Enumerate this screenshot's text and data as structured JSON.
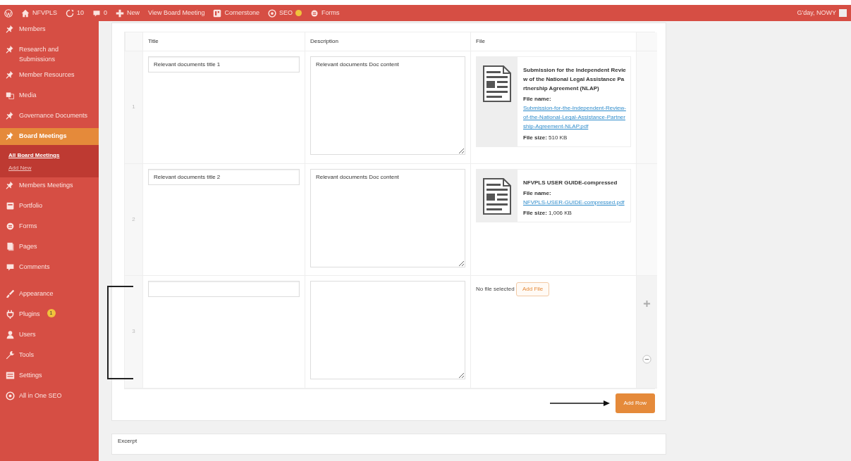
{
  "admin_bar": {
    "items": [
      {
        "kind": "wp-logo"
      },
      {
        "kind": "home",
        "label": "NFVPLS"
      },
      {
        "kind": "updates",
        "label": "10"
      },
      {
        "kind": "comments",
        "label": "0"
      },
      {
        "kind": "new",
        "label": "New"
      },
      {
        "kind": "text",
        "label": "View Board Meeting"
      },
      {
        "kind": "cornerstone",
        "label": "Cornerstone"
      },
      {
        "kind": "seo",
        "label": "SEO",
        "notice": true
      },
      {
        "kind": "forms",
        "label": "Forms"
      }
    ],
    "greeting": "G'day, NOWY"
  },
  "sidebar": {
    "items": [
      {
        "label": "Members",
        "selected": false
      },
      {
        "label": "Research and Submissions",
        "selected": false
      },
      {
        "label": "Member Resources",
        "selected": false
      },
      {
        "label": "Media",
        "selected": false
      },
      {
        "label": "Governance Documents",
        "selected": false
      },
      {
        "label": "Board Meetings",
        "selected": true,
        "children": [
          {
            "label": "All Board Meetings",
            "selected": true
          },
          {
            "label": "Add New",
            "selected": false
          }
        ]
      },
      {
        "label": "Members Meetings",
        "selected": false
      },
      {
        "label": "Portfolio",
        "selected": false
      },
      {
        "label": "Forms",
        "selected": false
      },
      {
        "label": "Pages",
        "selected": false
      },
      {
        "label": "Comments",
        "selected": false
      },
      {
        "label": "Appearance",
        "selected": false
      },
      {
        "label": "Plugins",
        "selected": false,
        "badge": "1"
      },
      {
        "label": "Users",
        "selected": false
      },
      {
        "label": "Tools",
        "selected": false
      },
      {
        "label": "Settings",
        "selected": false
      },
      {
        "label": "All in One SEO",
        "selected": false
      }
    ]
  },
  "repeater": {
    "columns": [
      "Title",
      "Description",
      "File"
    ],
    "rows": [
      {
        "number": "1",
        "title": "Relevant documents title 1",
        "description": "Relevant documents Doc content",
        "hovered": false,
        "file": {
          "title": "Submission for the Independent Review of the National Legal Assistance Partnership Agreement (NLAP)",
          "name_label": "File name:",
          "file_name": "Submission-for-the-Independent-Review-of-the-National-Legal-Assistance-Partnership-Agreement-NLAP.pdf",
          "size_label": "File size:",
          "size": "510 KB"
        }
      },
      {
        "number": "2",
        "title": "Relevant documents title 2",
        "description": "Relevant documents Doc content",
        "hovered": false,
        "file": {
          "title": "NFVPLS USER GUIDE-compressed",
          "name_label": "File name:",
          "file_name": "NFVPLS-USER-GUIDE-compressed.pdf",
          "size_label": "File size:",
          "size": "1,006 KB"
        }
      },
      {
        "number": "3",
        "hovered": true,
        "no_file_text": "No file selected",
        "add_file_button": "Add File"
      }
    ],
    "add_row_button": "Add Row"
  },
  "next_panel": {
    "title": "Excerpt"
  }
}
